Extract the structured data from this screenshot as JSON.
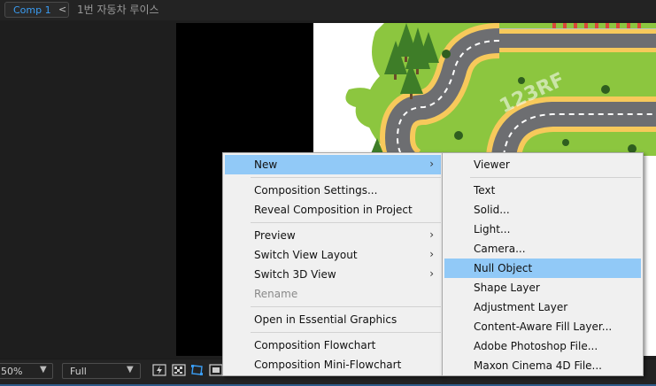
{
  "tabbar": {
    "comp_tab": "Comp 1",
    "tab_chevron": "<",
    "breadcrumb": "1번 자동차 루이스"
  },
  "viewer": {
    "watermark": "123RF"
  },
  "bottombar": {
    "zoom": "50%",
    "resolution": "Full",
    "icons": [
      "fast-previews-icon",
      "transparency-grid-icon",
      "mask-path-visibility-icon",
      "region-of-interest-icon"
    ]
  },
  "context_menu": {
    "items": [
      {
        "label": "New",
        "submenu": true,
        "highlighted": true
      },
      {
        "label": "Composition Settings..."
      },
      {
        "label": "Reveal Composition in Project"
      },
      {
        "label": "Preview",
        "submenu": true
      },
      {
        "label": "Switch View Layout",
        "submenu": true
      },
      {
        "label": "Switch 3D View",
        "submenu": true
      },
      {
        "label": "Rename",
        "disabled": true
      },
      {
        "label": "Open in Essential Graphics"
      },
      {
        "label": "Composition Flowchart"
      },
      {
        "label": "Composition Mini-Flowchart"
      }
    ],
    "submenu_arrow": "›"
  },
  "new_submenu": {
    "items": [
      {
        "label": "Viewer"
      },
      {
        "label": "Text"
      },
      {
        "label": "Solid..."
      },
      {
        "label": "Light..."
      },
      {
        "label": "Camera..."
      },
      {
        "label": "Null Object",
        "highlighted": true
      },
      {
        "label": "Shape Layer"
      },
      {
        "label": "Adjustment Layer"
      },
      {
        "label": "Content-Aware Fill Layer..."
      },
      {
        "label": "Adobe Photoshop File..."
      },
      {
        "label": "Maxon Cinema 4D File..."
      }
    ]
  },
  "colors": {
    "accent_blue": "#3a9cf2",
    "menu_highlight": "#91c9f7",
    "menu_bg": "#f0f0f0",
    "panel_bg": "#232323",
    "grass": "#8cc63f",
    "road": "#6d6e71",
    "road_edge": "#f7c95b"
  }
}
